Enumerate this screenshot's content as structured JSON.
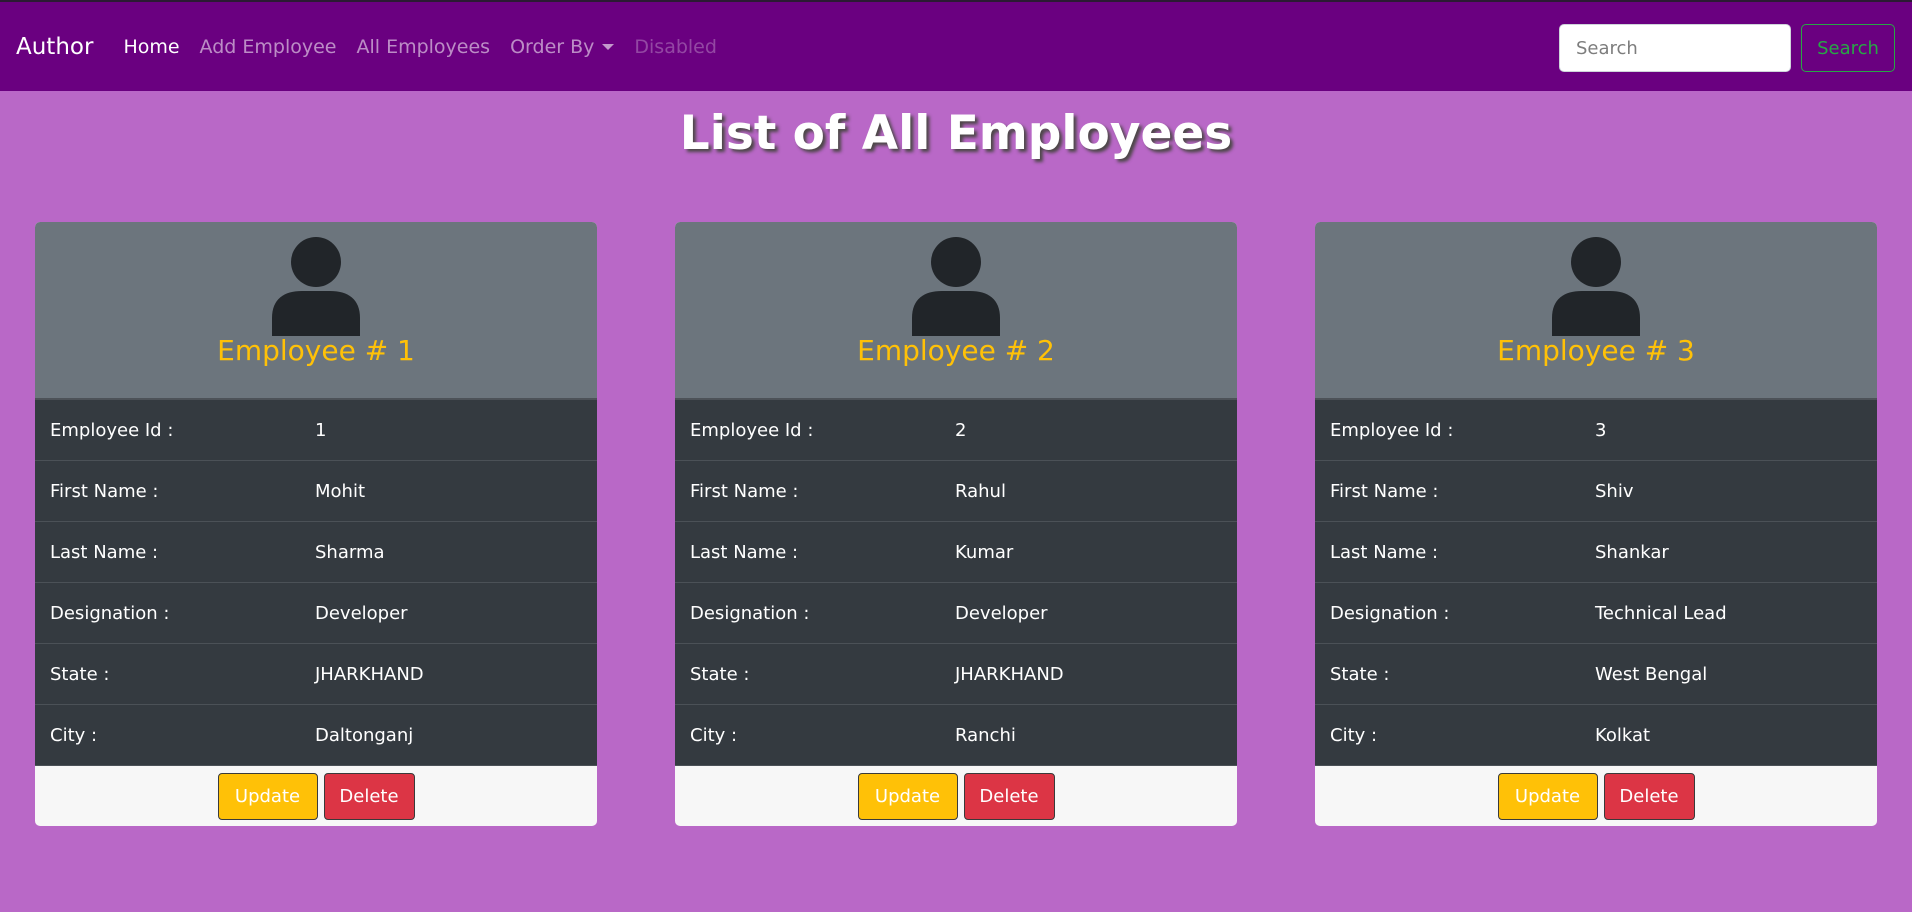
{
  "navbar": {
    "brand": "Author",
    "links": [
      {
        "label": "Home"
      },
      {
        "label": "Add Employee"
      },
      {
        "label": "All Employees"
      },
      {
        "label": "Order By"
      },
      {
        "label": "Disabled"
      }
    ],
    "search": {
      "placeholder": "Search",
      "button_label": "Search"
    }
  },
  "main": {
    "title": "List of All Employees",
    "employees": [
      {
        "title": "Employee # 1",
        "fields": [
          {
            "label": "Employee Id :",
            "value": "1"
          },
          {
            "label": "First Name :",
            "value": "Mohit"
          },
          {
            "label": "Last Name :",
            "value": "Sharma"
          },
          {
            "label": "Designation :",
            "value": "Developer"
          },
          {
            "label": "State :",
            "value": "JHARKHAND"
          },
          {
            "label": "City :",
            "value": "Daltonganj"
          }
        ],
        "update_label": "Update",
        "delete_label": "Delete"
      },
      {
        "title": "Employee # 2",
        "fields": [
          {
            "label": "Employee Id :",
            "value": "2"
          },
          {
            "label": "First Name :",
            "value": "Rahul"
          },
          {
            "label": "Last Name :",
            "value": "Kumar"
          },
          {
            "label": "Designation :",
            "value": "Developer"
          },
          {
            "label": "State :",
            "value": "JHARKHAND"
          },
          {
            "label": "City :",
            "value": "Ranchi"
          }
        ],
        "update_label": "Update",
        "delete_label": "Delete"
      },
      {
        "title": "Employee # 3",
        "fields": [
          {
            "label": "Employee Id :",
            "value": "3"
          },
          {
            "label": "First Name :",
            "value": "Shiv"
          },
          {
            "label": "Last Name :",
            "value": "Shankar"
          },
          {
            "label": "Designation :",
            "value": "Technical Lead"
          },
          {
            "label": "State :",
            "value": "West Bengal"
          },
          {
            "label": "City :",
            "value": "Kolkat"
          }
        ],
        "update_label": "Update",
        "delete_label": "Delete"
      }
    ]
  },
  "colors": {
    "page_bg": "#b968c7",
    "navbar_bg": "#6a0080",
    "card_header_bg": "#6c757d",
    "card_body_bg": "#343a40",
    "title_accent": "#ffc107",
    "update_button": "#ffc107",
    "delete_button": "#dc3545",
    "search_button": "#28a745"
  },
  "icons": {
    "avatar": "user-icon",
    "dropdown": "caret-down-icon"
  }
}
